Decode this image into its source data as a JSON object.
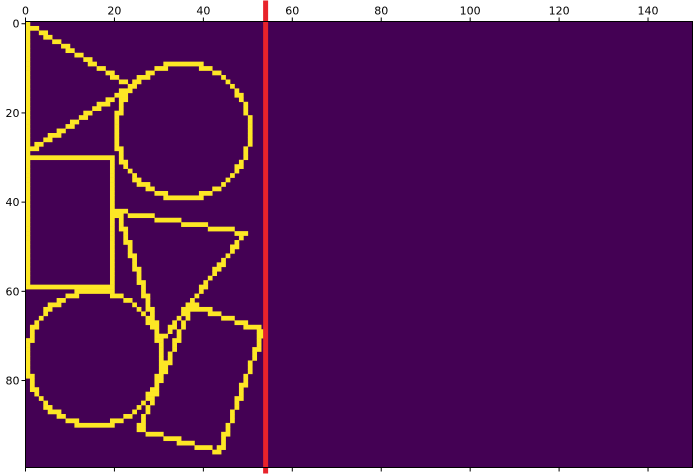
{
  "chart_data": {
    "type": "heatmap",
    "title": "",
    "xlabel": "",
    "ylabel": "",
    "grid": false,
    "xlim": [
      0,
      150
    ],
    "ylim": [
      100,
      0
    ],
    "x_ticks": [
      0,
      20,
      40,
      60,
      80,
      100,
      120,
      140
    ],
    "y_ticks": [
      0,
      20,
      40,
      60,
      80
    ],
    "colormap": {
      "low": "#440154",
      "high": "#fde725"
    },
    "background_value": 0,
    "vertical_line": {
      "x": 54,
      "color": "#e8232b"
    },
    "shapes": [
      {
        "kind": "polygon",
        "name": "triangle-top-left",
        "points": [
          [
            0,
            0
          ],
          [
            23,
            14
          ],
          [
            0,
            29
          ]
        ]
      },
      {
        "kind": "circle",
        "name": "circle-top",
        "center": [
          35,
          24
        ],
        "radius": 15
      },
      {
        "kind": "polygon",
        "name": "rectangle-left",
        "points": [
          [
            0,
            30
          ],
          [
            19,
            30
          ],
          [
            19,
            59
          ],
          [
            0,
            59
          ]
        ]
      },
      {
        "kind": "polygon",
        "name": "triangle-middle",
        "points": [
          [
            20,
            42
          ],
          [
            49,
            47
          ],
          [
            30,
            71
          ]
        ]
      },
      {
        "kind": "circle",
        "name": "circle-bottom",
        "center": [
          15,
          75
        ],
        "radius": 15
      },
      {
        "kind": "polygon",
        "name": "square-rotated",
        "points": [
          [
            37,
            63
          ],
          [
            53,
            69
          ],
          [
            43,
            96
          ],
          [
            25,
            91
          ]
        ]
      }
    ]
  }
}
